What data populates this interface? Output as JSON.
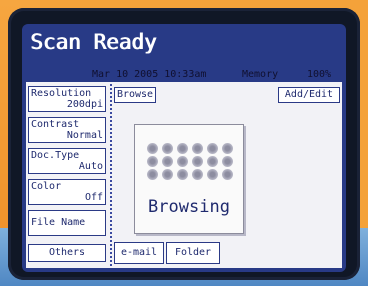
{
  "title": "Scan Ready",
  "status": {
    "datetime": "Mar 10 2005 10:33am",
    "memory_label": "Memory",
    "memory_value": "100%"
  },
  "side": {
    "resolution": {
      "label": "Resolution",
      "value": "200dpi"
    },
    "contrast": {
      "label": "Contrast",
      "value": "Normal"
    },
    "doc_type": {
      "label": "Doc.Type",
      "value": "Auto"
    },
    "color": {
      "label": "Color",
      "value": "Off"
    },
    "file_name": {
      "label": "File Name"
    },
    "others": {
      "label": "Others"
    }
  },
  "toolbar": {
    "browse": "Browse",
    "add_edit": "Add/Edit"
  },
  "browse_panel": {
    "status": "Browsing"
  },
  "tabs": {
    "email": "e-mail",
    "folder": "Folder"
  }
}
